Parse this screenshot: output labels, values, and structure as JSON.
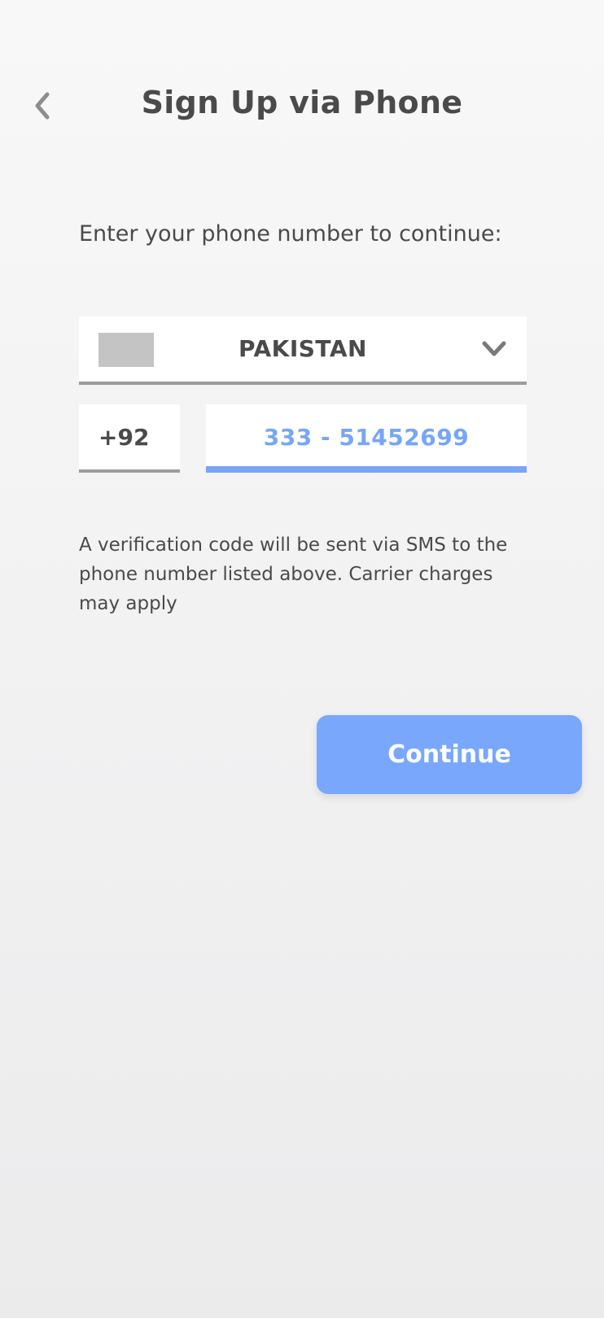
{
  "header": {
    "title": "Sign Up via Phone",
    "back_icon": "chevron-left-icon"
  },
  "form": {
    "prompt": "Enter your phone number to continue:",
    "country": {
      "name": "PAKISTAN",
      "flag_icon": "flag-placeholder-icon",
      "dropdown_icon": "chevron-down-icon"
    },
    "dial_code": "+92",
    "phone_value": "333 - 51452699",
    "notice": "A verification code will be sent via SMS to the phone number listed above. Carrier charges may apply"
  },
  "actions": {
    "continue_label": "Continue"
  },
  "colors": {
    "accent": "#78a7fc",
    "text": "#4a4a4a",
    "underline_inactive": "#9c9c9c",
    "flag_placeholder": "#c4c4c4"
  }
}
